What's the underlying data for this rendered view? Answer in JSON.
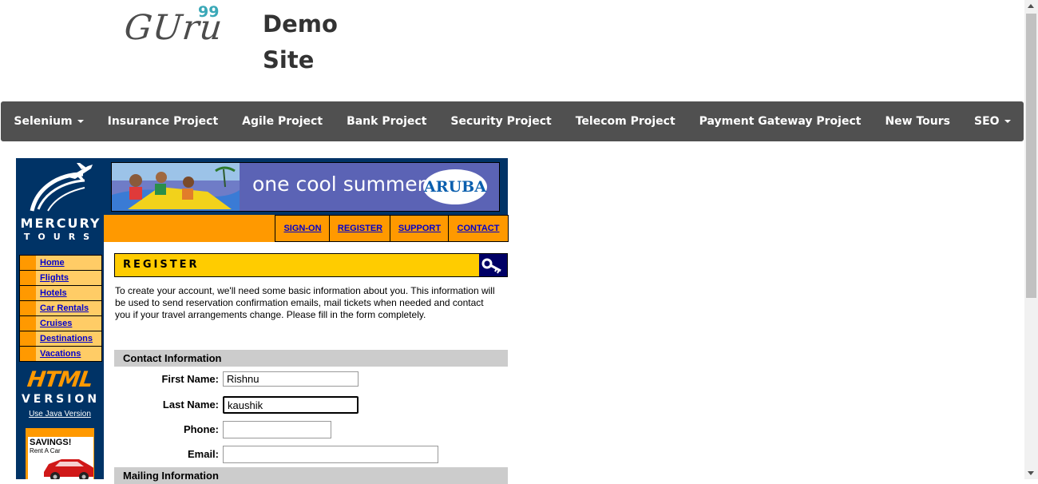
{
  "brand": {
    "logo_text": "GUru",
    "logo_sup": "99",
    "site_title": "Demo Site"
  },
  "nav": {
    "items": [
      {
        "label": "Selenium",
        "dropdown": true
      },
      {
        "label": "Insurance Project",
        "dropdown": false
      },
      {
        "label": "Agile Project",
        "dropdown": false
      },
      {
        "label": "Bank Project",
        "dropdown": false
      },
      {
        "label": "Security Project",
        "dropdown": false
      },
      {
        "label": "Telecom Project",
        "dropdown": false
      },
      {
        "label": "Payment Gateway Project",
        "dropdown": false
      },
      {
        "label": "New Tours",
        "dropdown": false
      },
      {
        "label": "SEO",
        "dropdown": true
      }
    ]
  },
  "mercury": {
    "logo_line1": "MERCURY",
    "logo_line2": "TOURS",
    "side_menu": [
      "Home",
      "Flights",
      "Hotels",
      "Car Rentals",
      "Cruises",
      "Destinations",
      "Vacations"
    ],
    "html_logo": "HTML",
    "version_word": "VERSION",
    "java_link": "Use Java Version",
    "savings_title": "SAVINGS!",
    "savings_sub": "Rent A Car",
    "banner_text": "one cool summer",
    "banner_logo": "ARUBA",
    "top_links": [
      "SIGN-ON",
      "REGISTER",
      "SUPPORT",
      "CONTACT"
    ],
    "page_heading": "REGISTER",
    "intro": "To create your account, we'll need some basic information about you. This information will be used to send reservation confirmation emails, mail tickets when needed and contact you if your travel arrangements change. Please fill in the form completely.",
    "contact_section": "Contact Information",
    "mailing_section": "Mailing Information",
    "fields": {
      "first_name_label": "First Name:",
      "first_name_value": "Rishnu",
      "last_name_label": "Last Name:",
      "last_name_value": "kaushik",
      "phone_label": "Phone:",
      "phone_value": "",
      "email_label": "Email:",
      "email_value": ""
    }
  },
  "colors": {
    "nav_bg": "#505050",
    "mercury_navy": "#003366",
    "mercury_orange": "#ff9900",
    "mercury_yellow": "#ffcc00",
    "link_blue": "#0000cc",
    "logo_accent": "#3aa8b7"
  }
}
